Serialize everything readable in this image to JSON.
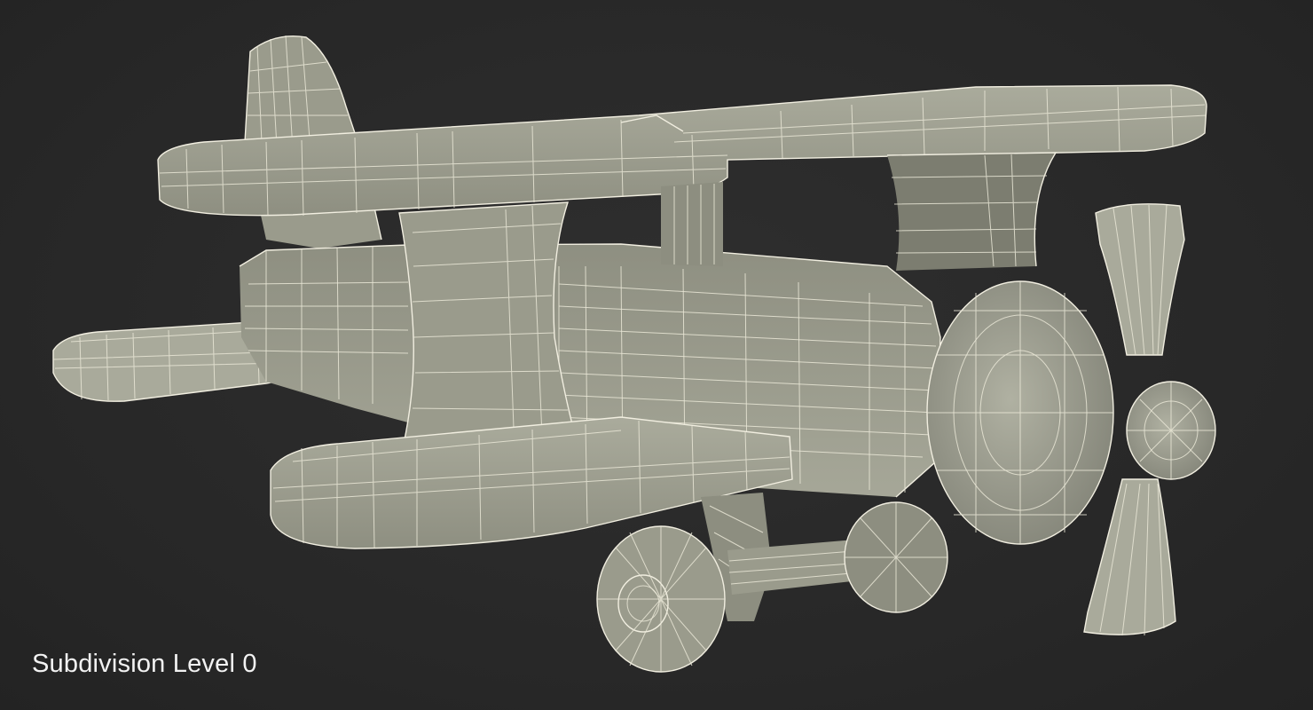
{
  "caption": "Subdivision Level 0",
  "colors": {
    "background": "#2a2a2a",
    "model_surface": "#9a9b8c",
    "wireframe": "#e9e6d6",
    "caption_text": "#f2f2f2"
  }
}
